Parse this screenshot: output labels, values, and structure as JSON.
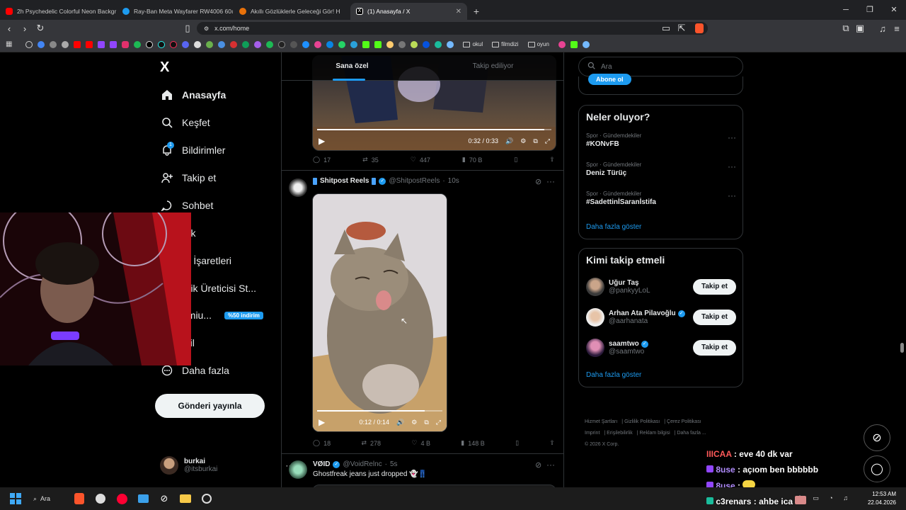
{
  "browser": {
    "tabs": [
      {
        "title": "2h Psychedelic Colorful Neon Backgr",
        "color": "#ff0000"
      },
      {
        "title": "Ray-Ban Meta Wayfarer RW4006 60ı",
        "color": "#1d9bf0"
      },
      {
        "title": "Akıllı Gözlüklerle Geleceği Gör! H",
        "color": "#e8710a"
      },
      {
        "title": "(1) Anasayfa / X",
        "color": "#ffffff"
      }
    ],
    "new_tab": "+",
    "url": "x.com/home",
    "bookmark_folders": [
      "okul",
      "filmdizi",
      "oyun"
    ]
  },
  "sidebar": {
    "logo": "X",
    "items": [
      {
        "label": "Anasayfa",
        "icon": "home-icon"
      },
      {
        "label": "Keşfet",
        "icon": "search-icon"
      },
      {
        "label": "Bildirimler",
        "icon": "bell-icon",
        "count": "1"
      },
      {
        "label": "Takip et",
        "icon": "add-user-icon"
      },
      {
        "label": "Sohbet",
        "icon": "chat-icon"
      },
      {
        "label": "rok",
        "icon": "grok-icon"
      },
      {
        "label": "er İşaretleri",
        "icon": "bookmark-icon"
      },
      {
        "label": "erik Üreticisi St...",
        "icon": "creator-icon"
      },
      {
        "label": "emiu...",
        "icon": "premium-icon",
        "badge": "%50 indirim"
      },
      {
        "label": "ofil",
        "icon": "profile-icon"
      },
      {
        "label": "Daha fazla",
        "icon": "more-icon"
      }
    ],
    "post_button": "Gönderi yayınla",
    "account": {
      "name": "burkai",
      "handle": "@itsburkai"
    }
  },
  "feed": {
    "tabs": [
      "Sana özel",
      "Takip ediliyor"
    ],
    "post1": {
      "video_time": "0:32 / 0:33",
      "progress": 0.97,
      "stats": {
        "replies": "17",
        "reposts": "35",
        "likes": "447",
        "views": "70 B"
      }
    },
    "post2": {
      "author": "Shitpost Reels",
      "handle": "@ShitpostReels",
      "time": "10s",
      "video_time": "0:12 / 0:14",
      "progress": 0.86,
      "stats": {
        "replies": "18",
        "reposts": "278",
        "likes": "4 B",
        "views": "148 B"
      }
    },
    "post3": {
      "author": "VØID",
      "handle": "@VoidRelnc",
      "time": "5s",
      "text": "Ghostfreak jeans just dropped 👻👖"
    }
  },
  "right": {
    "search_placeholder": "Ara",
    "subscribe_button": "Abone ol",
    "trends_title": "Neler oluyor?",
    "trends": [
      {
        "category": "Spor · Gündemdekiler",
        "name": "#KONvFB"
      },
      {
        "category": "Spor · Gündemdekiler",
        "name": "Deniz Türüç"
      },
      {
        "category": "Spor · Gündemdekiler",
        "name": "#SadettinİSaranİstifa"
      }
    ],
    "show_more": "Daha fazla göster",
    "who_title": "Kimi takip etmeli",
    "who": [
      {
        "name": "Uğur Taş",
        "handle": "@pankyyLoL",
        "verified": false
      },
      {
        "name": "Arhan Ata Pilavoğlu",
        "handle": "@aarhanata",
        "verified": true
      },
      {
        "name": "saamtwo",
        "handle": "@saamtwo",
        "verified": true
      }
    ],
    "follow_label": "Takip et",
    "footer": [
      "Hizmet Şartları",
      "Gizlilik Politikası",
      "Çerez Politikası",
      "Imprint",
      "Erişilebilirlik",
      "Reklam bilgisi",
      "Daha fazla ...",
      "© 2026 X Corp."
    ]
  },
  "stream_chat": [
    {
      "user": "IIICAA",
      "msg": ": eve 40 dk var",
      "color": "#ff5a5a"
    },
    {
      "user": "8use",
      "msg": ": açıom ben bbbbbb",
      "color": "#b18cff"
    },
    {
      "user": "8use",
      "msg": ":",
      "color": "#b18cff"
    },
    {
      "user": "c3renars",
      "msg": ": ahbe ica",
      "color": "#ffffff"
    }
  ],
  "taskbar": {
    "search": "Ara",
    "time": "12:53 AM",
    "date": "22.04.2026"
  }
}
